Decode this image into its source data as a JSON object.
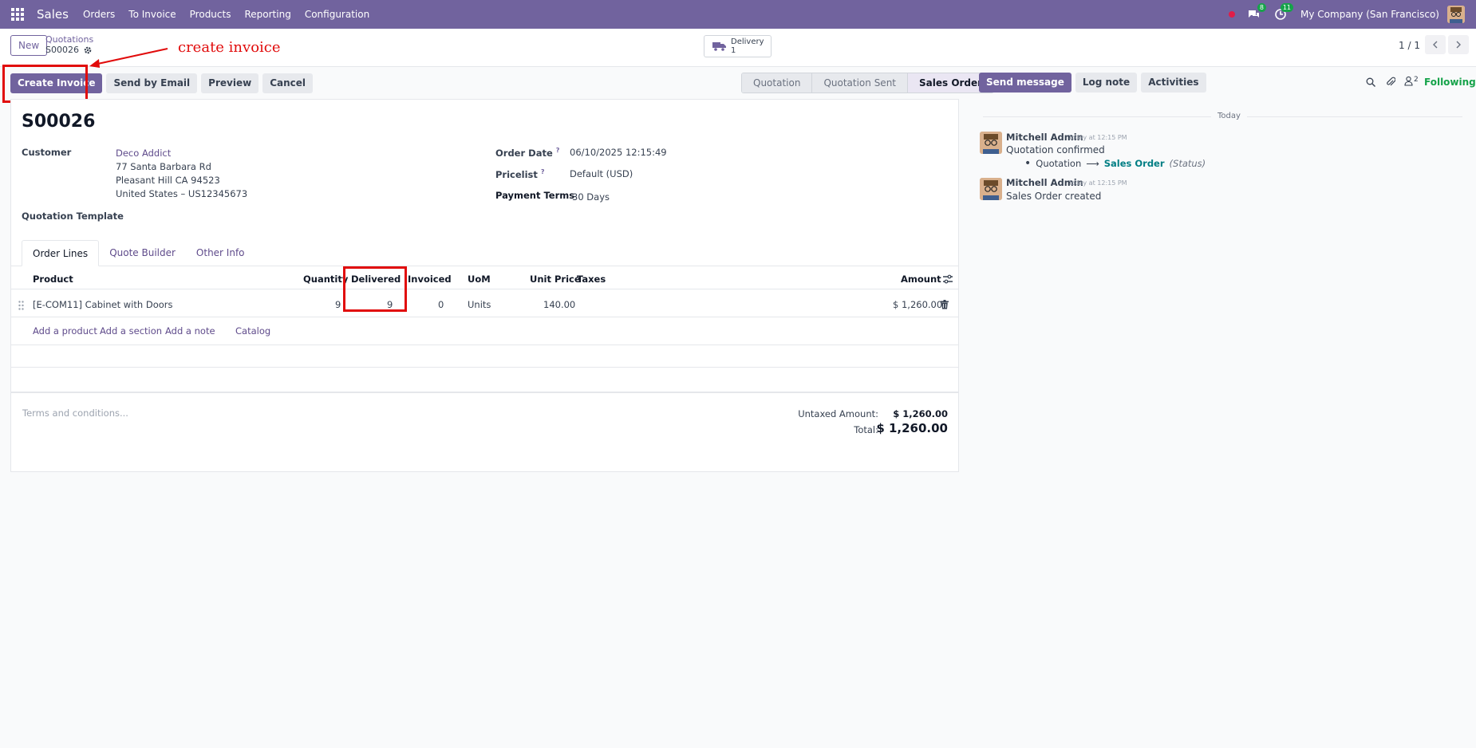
{
  "navbar": {
    "brand": "Sales",
    "menu": [
      "Orders",
      "To Invoice",
      "Products",
      "Reporting",
      "Configuration"
    ],
    "messages_badge": "8",
    "activities_badge": "11",
    "company": "My Company (San Francisco)"
  },
  "control": {
    "new_label": "New",
    "breadcrumb_parent": "Quotations",
    "breadcrumb_current": "S00026",
    "delivery_label": "Delivery",
    "delivery_count": "1",
    "pager": "1 / 1"
  },
  "annotation": {
    "text": "create invoice",
    "color": "#e10b0b"
  },
  "actions": {
    "create_invoice": "Create Invoice",
    "send_email": "Send by Email",
    "preview": "Preview",
    "cancel": "Cancel"
  },
  "stages": [
    "Quotation",
    "Quotation Sent",
    "Sales Order"
  ],
  "form": {
    "title": "S00026",
    "customer_label": "Customer",
    "customer_name": "Deco Addict",
    "address_line1": "77 Santa Barbara Rd",
    "address_line2": "Pleasant Hill CA 94523",
    "address_line3": "United States – US12345673",
    "template_label": "Quotation Template",
    "order_date_label": "Order Date",
    "order_date": "06/10/2025 12:15:49",
    "pricelist_label": "Pricelist",
    "pricelist": "Default (USD)",
    "payment_terms_label": "Payment Terms",
    "payment_terms": "30 Days",
    "help_mark": "?"
  },
  "tabs": [
    "Order Lines",
    "Quote Builder",
    "Other Info"
  ],
  "lines": {
    "headers": {
      "product": "Product",
      "quantity": "Quantity",
      "delivered": "Delivered",
      "invoiced": "Invoiced",
      "uom": "UoM",
      "unit_price": "Unit Price",
      "taxes": "Taxes",
      "amount": "Amount"
    },
    "row": {
      "product": "[E-COM11] Cabinet with Doors",
      "quantity": "9",
      "delivered": "9",
      "invoiced": "0",
      "uom": "Units",
      "unit_price": "140.00",
      "amount": "$ 1,260.00"
    },
    "add_product": "Add a product",
    "add_section": "Add a section",
    "add_note": "Add a note",
    "catalog": "Catalog"
  },
  "totals": {
    "terms_placeholder": "Terms and conditions...",
    "untaxed_label": "Untaxed Amount:",
    "untaxed_value": "$ 1,260.00",
    "total_label": "Total:",
    "total_value": "$ 1,260.00"
  },
  "chatter": {
    "send_message": "Send message",
    "log_note": "Log note",
    "activities": "Activities",
    "followers_count": "2",
    "following": "Following",
    "today": "Today",
    "messages": [
      {
        "author": "Mitchell Admin",
        "time": "Today at 12:15 PM",
        "body": "Quotation confirmed",
        "change_from": "Quotation",
        "change_to": "Sales Order",
        "change_field": "(Status)"
      },
      {
        "author": "Mitchell Admin",
        "time": "Today at 12:15 PM",
        "body": "Sales Order created"
      }
    ]
  },
  "colors": {
    "brand": "#71639e",
    "link": "#5f4b8b",
    "following": "#16a34a"
  }
}
